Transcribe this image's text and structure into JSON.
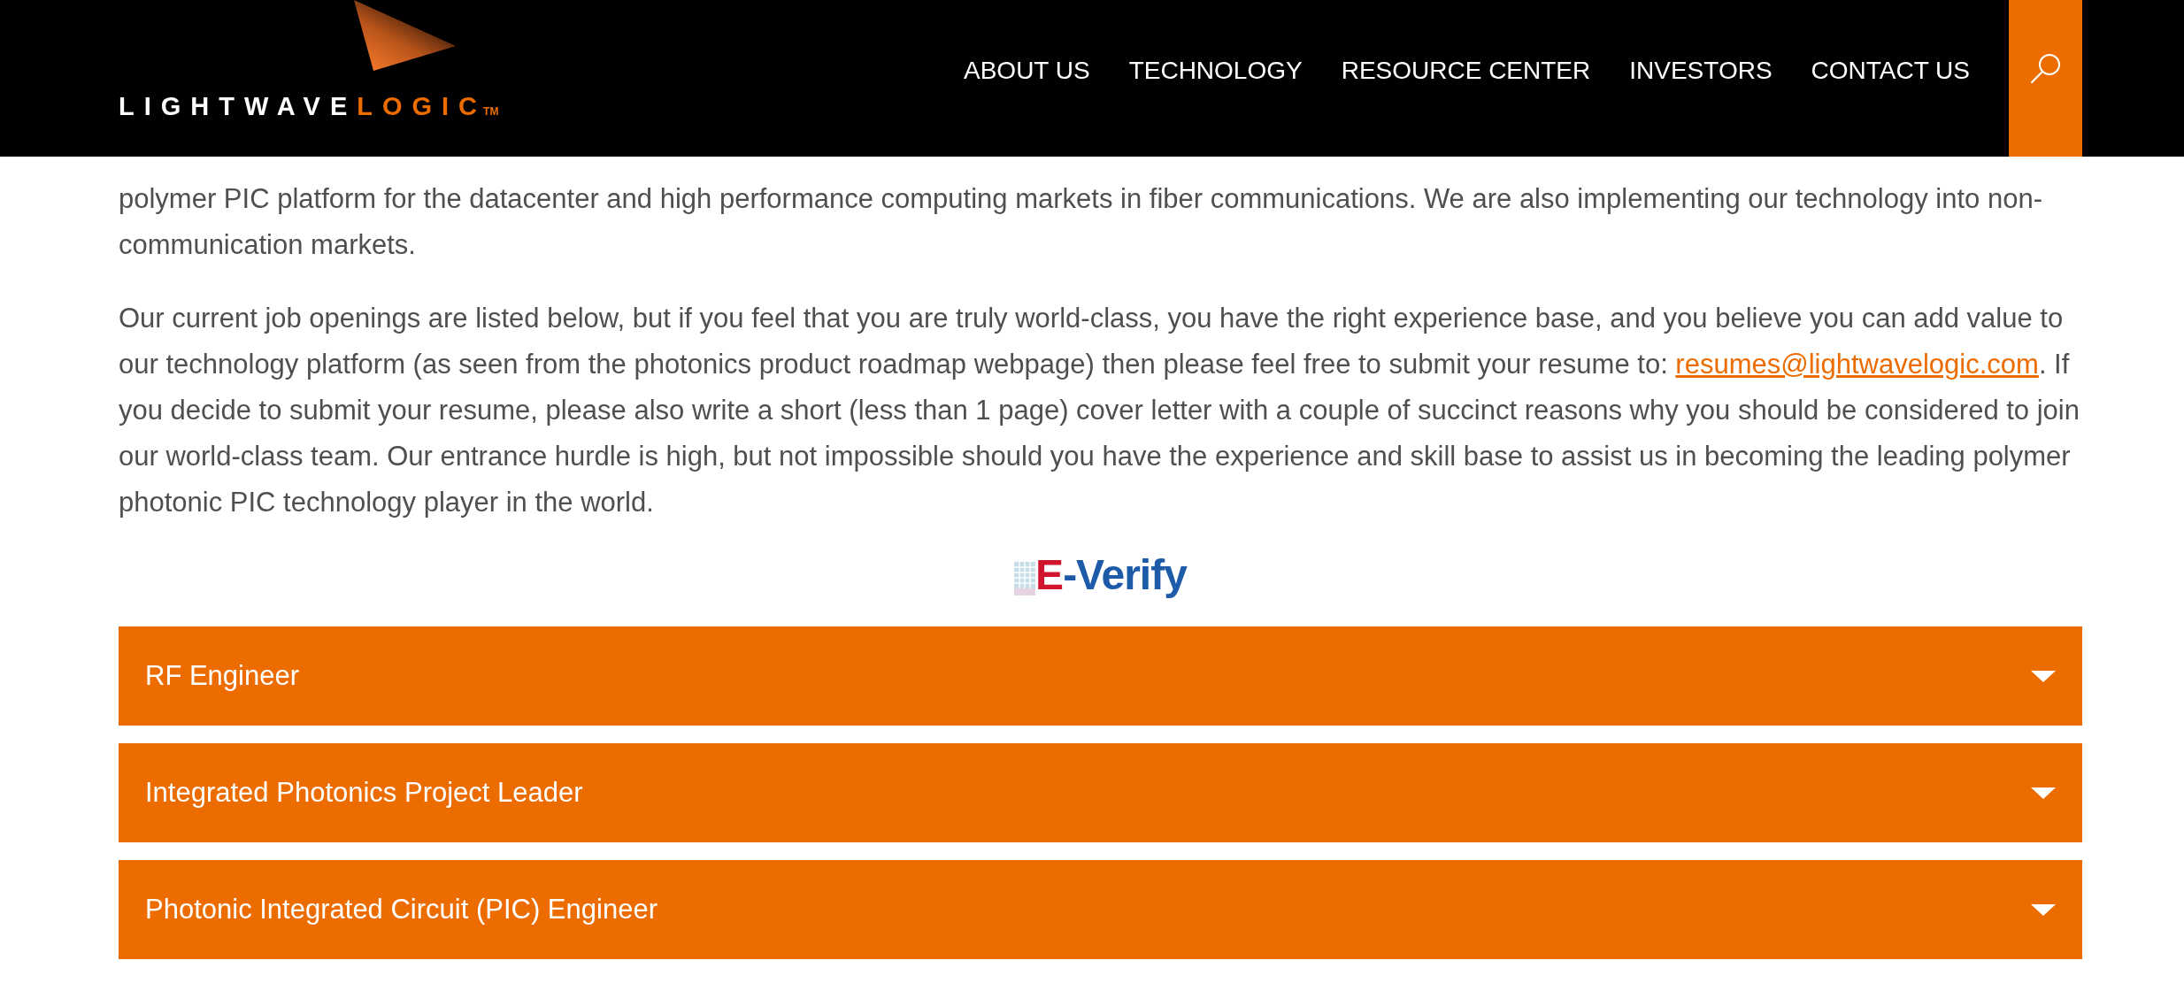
{
  "header": {
    "logo": {
      "light": "LIGHTWAVE",
      "accent": "LOGIC",
      "mark": "TM"
    },
    "nav": [
      {
        "label": "ABOUT US"
      },
      {
        "label": "TECHNOLOGY"
      },
      {
        "label": "RESOURCE CENTER"
      },
      {
        "label": "INVESTORS"
      },
      {
        "label": "CONTACT US"
      }
    ]
  },
  "intro": [
    {
      "text": "polymer PIC platform for the datacenter and high performance computing markets in fiber communications. We are also implementing our technology into non-communication markets."
    },
    {
      "text": "Our current job openings are listed below, but if you feel that you are truly world-class, you have the right experience base, and you believe you can add value to our technology platform (as seen from the photonics product roadmap webpage) then please feel free to submit your resume to: ",
      "link": "resumes@lightwavelogic.com",
      "after": ". If you decide to submit your resume, please also write a short (less than 1 page) cover letter with a couple of succinct reasons why you should be considered to join our world-class team. Our entrance hurdle is high, but not impossible should you have the experience and skill base to assist us in becoming the leading polymer photonic PIC technology player in the world."
    }
  ],
  "verification_logo": {
    "letter": "E",
    "rest": "-Verify"
  },
  "jobs": [
    {
      "title": "RF Engineer",
      "expanded": false
    },
    {
      "title": "Integrated Photonics Project Leader",
      "expanded": false
    },
    {
      "title": "Photonic Integrated Circuit (PIC) Engineer",
      "expanded": false
    }
  ]
}
